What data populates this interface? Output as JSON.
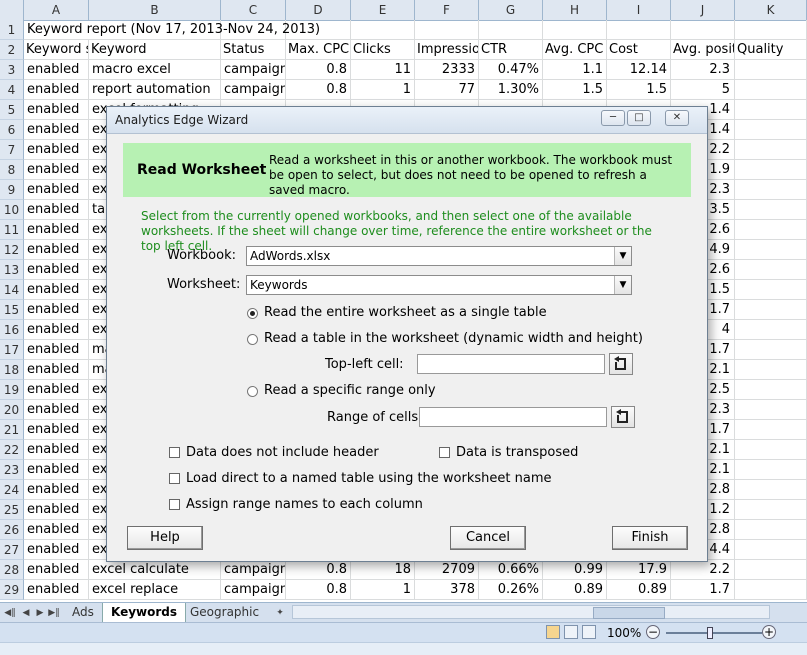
{
  "columns": [
    "A",
    "B",
    "C",
    "D",
    "E",
    "F",
    "G",
    "H",
    "I",
    "J",
    "K"
  ],
  "rows_headers": [
    "1",
    "2",
    "3",
    "4",
    "5",
    "6",
    "7",
    "8",
    "9",
    "10",
    "11",
    "12",
    "13",
    "14",
    "15",
    "16",
    "17",
    "18",
    "19",
    "20",
    "21",
    "22",
    "23",
    "24",
    "25",
    "26",
    "27",
    "28",
    "29"
  ],
  "report_title": "Keyword report (Nov 17, 2013-Nov 24, 2013)",
  "table_header": [
    "Keyword s",
    "Keyword",
    "Status",
    "Max. CPC",
    "Clicks",
    "Impressio",
    "CTR",
    "Avg. CPC",
    "Cost",
    "Avg. posit",
    "Quality"
  ],
  "rows": [
    [
      "enabled",
      "macro excel",
      "campaign",
      "0.8",
      "11",
      "2333",
      "0.47%",
      "1.1",
      "12.14",
      "2.3"
    ],
    [
      "enabled",
      "report automation",
      "campaign",
      "0.8",
      "1",
      "77",
      "1.30%",
      "1.5",
      "1.5",
      "5"
    ],
    [
      "enabled",
      "excel formatting",
      "",
      "",
      "",
      "",
      "",
      "",
      "",
      "1.4"
    ],
    [
      "enabled",
      "ex",
      "",
      "",
      "",
      "",
      "",
      "",
      "",
      "1.4"
    ],
    [
      "enabled",
      "ex",
      "",
      "",
      "",
      "",
      "",
      "",
      "",
      "2.2"
    ],
    [
      "enabled",
      "ex",
      "",
      "",
      "",
      "",
      "",
      "",
      "",
      "1.9"
    ],
    [
      "enabled",
      "ex",
      "",
      "",
      "",
      "",
      "",
      "",
      "",
      "2.3"
    ],
    [
      "enabled",
      "tal",
      "",
      "",
      "",
      "",
      "",
      "",
      "",
      "3.5"
    ],
    [
      "enabled",
      "ex",
      "",
      "",
      "",
      "",
      "",
      "",
      "",
      "2.6"
    ],
    [
      "enabled",
      "ex",
      "",
      "",
      "",
      "",
      "",
      "",
      "",
      "4.9"
    ],
    [
      "enabled",
      "ex",
      "",
      "",
      "",
      "",
      "",
      "",
      "",
      "2.6"
    ],
    [
      "enabled",
      "ex",
      "",
      "",
      "",
      "",
      "",
      "",
      "",
      "1.5"
    ],
    [
      "enabled",
      "ex",
      "",
      "",
      "",
      "",
      "",
      "",
      "",
      "1.7"
    ],
    [
      "enabled",
      "ex",
      "",
      "",
      "",
      "",
      "",
      "",
      "",
      "4"
    ],
    [
      "enabled",
      "ma",
      "",
      "",
      "",
      "",
      "",
      "",
      "",
      "1.7"
    ],
    [
      "enabled",
      "ma",
      "",
      "",
      "",
      "",
      "",
      "",
      "",
      "2.1"
    ],
    [
      "enabled",
      "ex",
      "",
      "",
      "",
      "",
      "",
      "",
      "",
      "2.5"
    ],
    [
      "enabled",
      "ex",
      "",
      "",
      "",
      "",
      "",
      "",
      "",
      "2.3"
    ],
    [
      "enabled",
      "ex",
      "",
      "",
      "",
      "",
      "",
      "",
      "",
      "1.7"
    ],
    [
      "enabled",
      "ex",
      "",
      "",
      "",
      "",
      "",
      "",
      "",
      "2.1"
    ],
    [
      "enabled",
      "ex",
      "",
      "",
      "",
      "",
      "",
      "",
      "",
      "2.1"
    ],
    [
      "enabled",
      "ex",
      "",
      "",
      "",
      "",
      "",
      "",
      "",
      "2.8"
    ],
    [
      "enabled",
      "ex",
      "",
      "",
      "",
      "",
      "",
      "",
      "",
      "1.2"
    ],
    [
      "enabled",
      "ex",
      "",
      "",
      "",
      "",
      "",
      "",
      "",
      "2.8"
    ],
    [
      "enabled",
      "ex",
      "",
      "",
      "",
      "",
      "",
      "",
      "",
      "4.4"
    ],
    [
      "enabled",
      "excel calculate",
      "campaign",
      "0.8",
      "18",
      "2709",
      "0.66%",
      "0.99",
      "17.9",
      "2.2"
    ],
    [
      "enabled",
      "excel replace",
      "campaign",
      "0.8",
      "1",
      "378",
      "0.26%",
      "0.89",
      "0.89",
      "1.7"
    ]
  ],
  "sheet_tabs": [
    {
      "label": "Ads",
      "active": false
    },
    {
      "label": "Keywords",
      "active": true
    },
    {
      "label": "Geographic",
      "active": false
    }
  ],
  "zoom": "100%",
  "zoom_minus": "−",
  "zoom_plus": "+",
  "dialog": {
    "title": "Analytics Edge Wizard",
    "banner_title": "Read Worksheet",
    "banner_desc": "Read a worksheet in this or another workbook. The workbook must be open to select, but does not need to be opened to refresh a saved macro.",
    "intro": "Select from the currently opened workbooks, and then select one of the available worksheets. If the sheet will change over time, reference the entire worksheet or the top left cell.",
    "workbook_label": "Workbook:",
    "workbook_value": "AdWords.xlsx",
    "worksheet_label": "Worksheet:",
    "worksheet_value": "Keywords",
    "radio_entire": "Read the entire worksheet as a single table",
    "radio_table": "Read a table in the worksheet (dynamic width and height)",
    "topleft_label": "Top-left cell:",
    "radio_range": "Read a specific range only",
    "range_label": "Range of cells:",
    "chk_no_header": "Data does not include header",
    "chk_transposed": "Data is transposed",
    "chk_named_table": "Load direct to a named table using the worksheet name",
    "chk_range_names": "Assign range names to each column",
    "btn_help": "Help",
    "btn_cancel": "Cancel",
    "btn_finish": "Finish",
    "selected_option": "entire"
  }
}
